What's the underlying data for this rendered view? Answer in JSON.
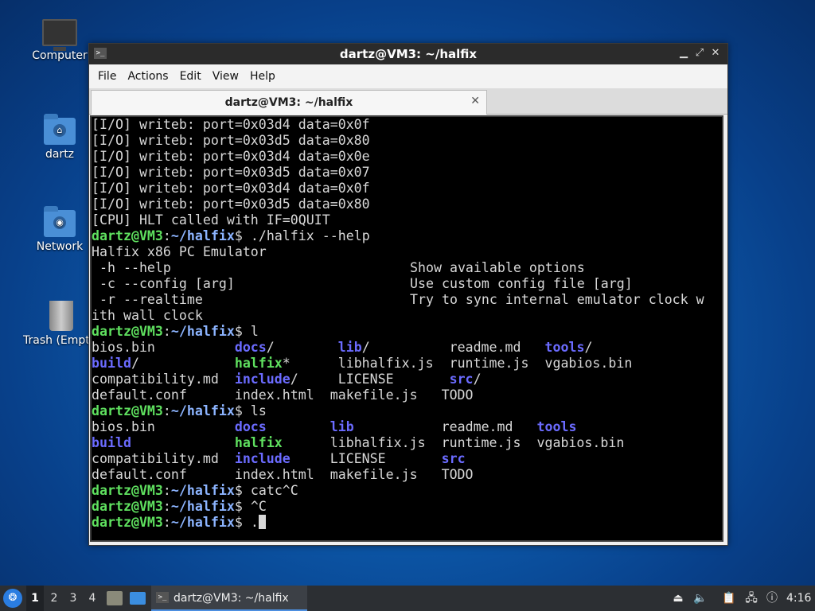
{
  "desktop": {
    "icons": [
      {
        "label": "Computer"
      },
      {
        "label": "dartz"
      },
      {
        "label": "Network"
      },
      {
        "label": "Trash (Empty)"
      }
    ]
  },
  "window": {
    "title": "dartz@VM3: ~/halfix",
    "menu": [
      "File",
      "Edit",
      "View",
      "Help"
    ],
    "menu_actions": "Actions",
    "tab_label": "dartz@VM3: ~/halfix"
  },
  "terminal": {
    "lines": [
      "[I/O] writeb: port=0x03d4 data=0x0f",
      "[I/O] writeb: port=0x03d5 data=0x80",
      "[I/O] writeb: port=0x03d4 data=0x0e",
      "[I/O] writeb: port=0x03d5 data=0x07",
      "[I/O] writeb: port=0x03d4 data=0x0f",
      "[I/O] writeb: port=0x03d5 data=0x80",
      "[CPU] HLT called with IF=0QUIT"
    ],
    "prompt_user": "dartz@VM3",
    "prompt_path": "~/halfix",
    "cmd_help": "./halfix --help",
    "help_title": "Halfix x86 PC Emulator",
    "help_opts": [
      {
        "flag": " -h --help",
        "desc": "Show available options"
      },
      {
        "flag": " -c --config [arg]",
        "desc": "Use custom config file [arg]"
      },
      {
        "flag": " -r --realtime",
        "desc": "Try to sync internal emulator clock w"
      }
    ],
    "help_wrap": "ith wall clock",
    "cmd_l": "l",
    "cmd_ls": "ls",
    "cmd_cat": "catc^C",
    "cmd_ctrl": "^C",
    "cmd_last": "."
  },
  "taskbar": {
    "workspaces": [
      "1",
      "2",
      "3",
      "4"
    ],
    "task_label": "dartz@VM3: ~/halfix",
    "clock": "4:16"
  }
}
